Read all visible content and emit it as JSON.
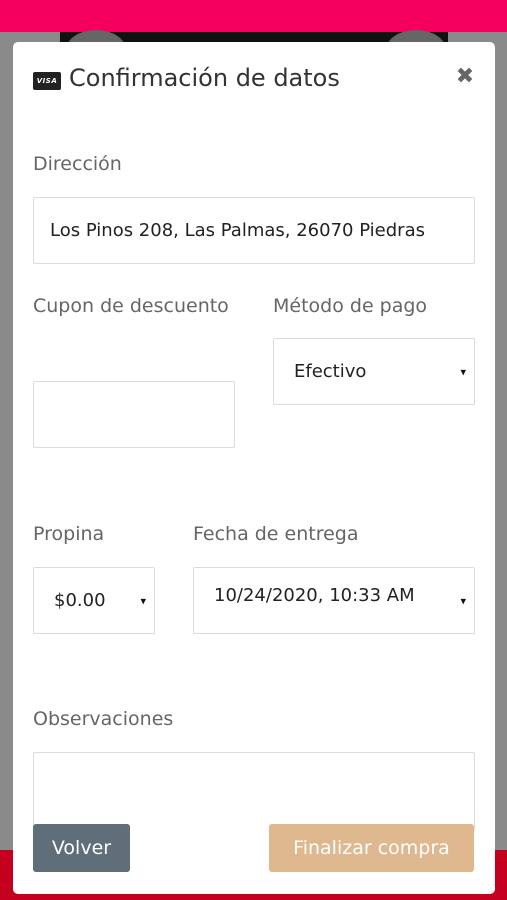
{
  "modal": {
    "title": "Confirmación de datos",
    "card_icon": "visa-card-icon",
    "card_icon_text": "VISA",
    "close_icon": "close-icon",
    "close_glyph": "✖"
  },
  "form": {
    "address_label": "Dirección",
    "address_value": "Los Pinos 208, Las Palmas, 26070 Piedras",
    "coupon_label": "Cupon de descuento",
    "coupon_value": "",
    "payment_label": "Método de pago",
    "payment_value": "Efectivo",
    "tip_label": "Propina",
    "tip_value": "$0.00",
    "delivery_label": "Fecha de entrega",
    "delivery_value": "10/24/2020, 10:33 AM",
    "notes_label": "Observaciones",
    "notes_value": "",
    "dropdown_glyph": "▾"
  },
  "buttons": {
    "back_label": "Volver",
    "finish_label": "Finalizar compra"
  },
  "colors": {
    "top_bar": "#f5005f",
    "bottom_bar": "#c4001e",
    "back_button": "#5f6e79",
    "finish_button": "#dfb88f"
  }
}
